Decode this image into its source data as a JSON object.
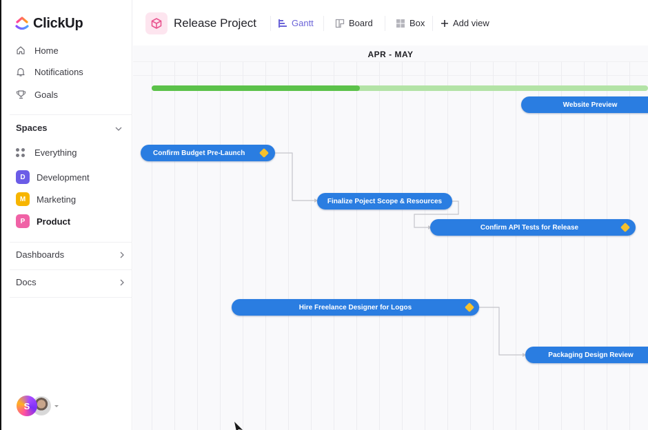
{
  "app": {
    "name": "ClickUp"
  },
  "sidebar": {
    "nav": [
      {
        "label": "Home",
        "icon": "home-icon"
      },
      {
        "label": "Notifications",
        "icon": "bell-icon"
      },
      {
        "label": "Goals",
        "icon": "trophy-icon"
      }
    ],
    "spaces_heading": "Spaces",
    "everything_label": "Everything",
    "spaces": [
      {
        "label": "Development",
        "initial": "D",
        "color": "#6b5ce7",
        "bold": false
      },
      {
        "label": "Marketing",
        "initial": "M",
        "color": "#f7b500",
        "bold": false
      },
      {
        "label": "Product",
        "initial": "P",
        "color": "#f062a6",
        "bold": true
      }
    ],
    "dashboards_label": "Dashboards",
    "docs_label": "Docs",
    "user_initial": "S"
  },
  "header": {
    "project_title": "Release Project",
    "views": [
      {
        "label": "Gantt",
        "icon": "gantt-icon",
        "active": true
      },
      {
        "label": "Board",
        "icon": "board-icon",
        "active": false
      },
      {
        "label": "Box",
        "icon": "box-grid-icon",
        "active": false
      }
    ],
    "add_view_label": "Add view"
  },
  "gantt": {
    "range_label": "APR - MAY",
    "project_progress": 0.42,
    "colors": {
      "task": "#2a7de1",
      "progress": "#5cc24a",
      "progress_track": "#b3e3a6",
      "milestone": "#f5c02c"
    },
    "tasks": [
      {
        "name": "Website Preview",
        "milestone": false
      },
      {
        "name": "Confirm Budget Pre-Launch",
        "milestone": true
      },
      {
        "name": "Finalize Poject Scope & Resources",
        "milestone": false
      },
      {
        "name": "Confirm API Tests for Release",
        "milestone": true
      },
      {
        "name": "Hire Freelance Designer for Logos",
        "milestone": true
      },
      {
        "name": "Packaging Design Review",
        "milestone": false
      }
    ]
  }
}
